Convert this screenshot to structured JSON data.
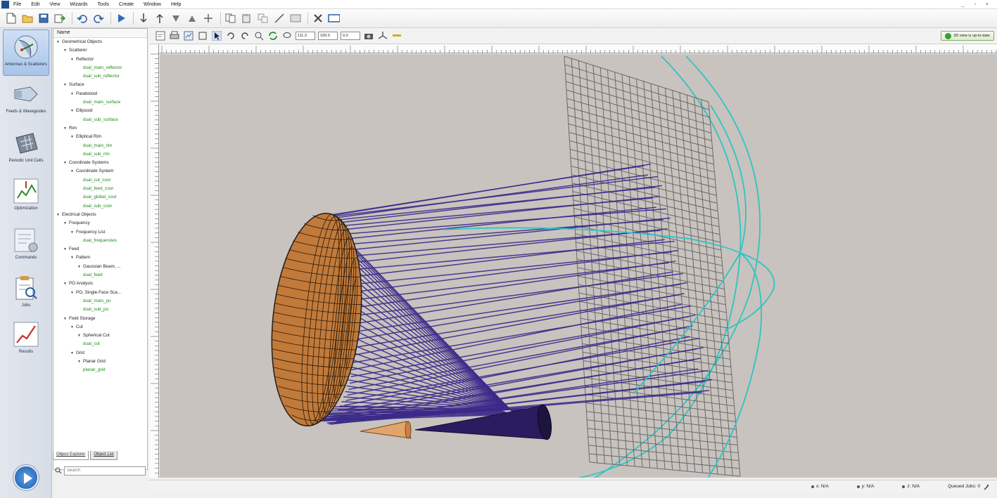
{
  "menu": [
    "File",
    "Edit",
    "View",
    "Wizards",
    "Tools",
    "Create",
    "Window",
    "Help"
  ],
  "window_controls": "_ ▫ ×",
  "ribbon": [
    {
      "label": "Antennas & Scatterers",
      "icon": "antenna-icon",
      "active": true
    },
    {
      "label": "Feeds & Waveguides",
      "icon": "feed-icon",
      "active": false
    },
    {
      "label": "Periodic Unit Cells",
      "icon": "unit-cell-icon",
      "active": false
    },
    {
      "label": "Optimization",
      "icon": "optimization-icon",
      "active": false
    },
    {
      "label": "Commands",
      "icon": "commands-icon",
      "active": false
    },
    {
      "label": "Jobs",
      "icon": "jobs-icon",
      "active": false
    },
    {
      "label": "Results",
      "icon": "results-icon",
      "active": false
    }
  ],
  "tree": {
    "header": "Name",
    "items": [
      {
        "label": "Geometrical Objects",
        "indent": 0,
        "expander": true,
        "obj": false
      },
      {
        "label": "Scatterer",
        "indent": 1,
        "expander": true,
        "obj": false
      },
      {
        "label": "Reflector",
        "indent": 2,
        "expander": true,
        "obj": false
      },
      {
        "label": "dual_main_reflector",
        "indent": 3,
        "expander": false,
        "obj": true
      },
      {
        "label": "dual_sub_reflector",
        "indent": 3,
        "expander": false,
        "obj": true
      },
      {
        "label": "Surface",
        "indent": 1,
        "expander": true,
        "obj": false
      },
      {
        "label": "Paraboloid",
        "indent": 2,
        "expander": true,
        "obj": false
      },
      {
        "label": "dual_main_surface",
        "indent": 3,
        "expander": false,
        "obj": true
      },
      {
        "label": "Ellipsoid",
        "indent": 2,
        "expander": true,
        "obj": false
      },
      {
        "label": "dual_sub_surface",
        "indent": 3,
        "expander": false,
        "obj": true
      },
      {
        "label": "Rim",
        "indent": 1,
        "expander": true,
        "obj": false
      },
      {
        "label": "Elliptical Rim",
        "indent": 2,
        "expander": true,
        "obj": false
      },
      {
        "label": "dual_main_rim",
        "indent": 3,
        "expander": false,
        "obj": true
      },
      {
        "label": "dual_sub_rim",
        "indent": 3,
        "expander": false,
        "obj": true
      },
      {
        "label": "Coordinate Systems",
        "indent": 1,
        "expander": true,
        "obj": false
      },
      {
        "label": "Coordinate System",
        "indent": 2,
        "expander": true,
        "obj": false
      },
      {
        "label": "dual_cut_coor",
        "indent": 3,
        "expander": false,
        "obj": true
      },
      {
        "label": "dual_feed_coor",
        "indent": 3,
        "expander": false,
        "obj": true
      },
      {
        "label": "dual_global_coor",
        "indent": 3,
        "expander": false,
        "obj": true
      },
      {
        "label": "dual_sub_coor",
        "indent": 3,
        "expander": false,
        "obj": true
      },
      {
        "label": "Electrical Objects",
        "indent": 0,
        "expander": true,
        "obj": false
      },
      {
        "label": "Frequency",
        "indent": 1,
        "expander": true,
        "obj": false
      },
      {
        "label": "Frequency List",
        "indent": 2,
        "expander": true,
        "obj": false
      },
      {
        "label": "dual_frequencies",
        "indent": 3,
        "expander": false,
        "obj": true
      },
      {
        "label": "Feed",
        "indent": 1,
        "expander": true,
        "obj": false
      },
      {
        "label": "Pattern",
        "indent": 2,
        "expander": true,
        "obj": false
      },
      {
        "label": "Gaussian Beam, ...",
        "indent": 3,
        "expander": true,
        "obj": false
      },
      {
        "label": "dual_feed",
        "indent": 3,
        "expander": false,
        "obj": true
      },
      {
        "label": "PO Analysis",
        "indent": 1,
        "expander": true,
        "obj": false
      },
      {
        "label": "PO, Single-Face Sca...",
        "indent": 2,
        "expander": true,
        "obj": false
      },
      {
        "label": "dual_main_po",
        "indent": 3,
        "expander": false,
        "obj": true
      },
      {
        "label": "dual_sub_po",
        "indent": 3,
        "expander": false,
        "obj": true
      },
      {
        "label": "Field Storage",
        "indent": 1,
        "expander": true,
        "obj": false
      },
      {
        "label": "Cut",
        "indent": 2,
        "expander": true,
        "obj": false
      },
      {
        "label": "Spherical Cut",
        "indent": 3,
        "expander": true,
        "obj": false
      },
      {
        "label": "dual_cut",
        "indent": 3,
        "expander": false,
        "obj": true
      },
      {
        "label": "Grid",
        "indent": 2,
        "expander": true,
        "obj": false
      },
      {
        "label": "Planar Grid",
        "indent": 3,
        "expander": true,
        "obj": false
      },
      {
        "label": "planar_grid",
        "indent": 3,
        "expander": false,
        "obj": true
      }
    ]
  },
  "tabs": [
    "Object Explorer",
    "Object List"
  ],
  "search_placeholder": "Search",
  "view_inputs": [
    "111.3",
    "100.0",
    "0.0"
  ],
  "status_ok": "3D view is up-to-date",
  "status": {
    "x": "x: N/A",
    "y": "y: N/A",
    "z": "z: N/A",
    "queued": "Queued Jobs: 0"
  },
  "colors": {
    "viewport_bg": "#c8c3be",
    "reflector": "#c17a3a",
    "rays": "#3b2a8a",
    "grid": "#6a6a6a",
    "cut": "#2ec4c4"
  }
}
